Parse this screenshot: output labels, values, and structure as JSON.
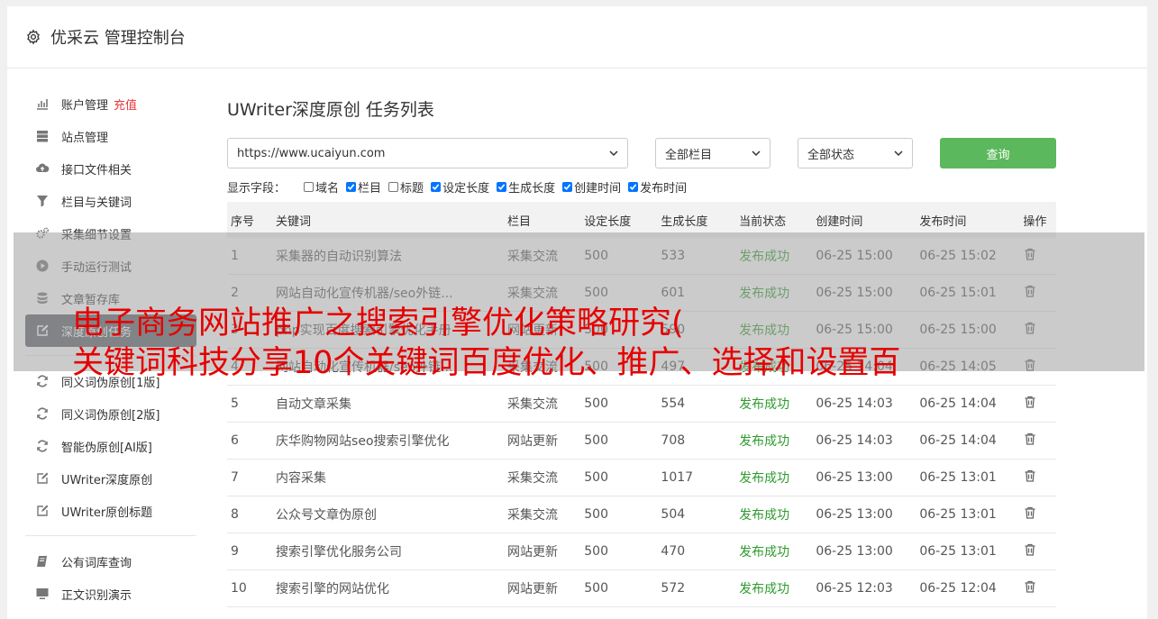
{
  "header": {
    "title": "优采云 管理控制台"
  },
  "sidebar": {
    "items": [
      {
        "label": "账户管理",
        "extra": "充值",
        "icon": "bar-chart-icon"
      },
      {
        "label": "站点管理",
        "icon": "server-icon"
      },
      {
        "label": "接口文件相关",
        "icon": "cloud-upload-icon"
      },
      {
        "label": "栏目与关键词",
        "icon": "filter-icon"
      },
      {
        "label": "采集细节设置",
        "icon": "gears-icon"
      },
      {
        "label": "手动运行测试",
        "icon": "play-icon"
      },
      {
        "label": "文章暂存库",
        "icon": "database-icon"
      },
      {
        "label": "深度原创任务",
        "icon": "edit-icon"
      }
    ],
    "items2": [
      {
        "label": "同义词伪原创[1版]",
        "icon": "refresh-icon"
      },
      {
        "label": "同义词伪原创[2版]",
        "icon": "refresh-icon"
      },
      {
        "label": "智能伪原创[AI版]",
        "icon": "refresh-icon"
      },
      {
        "label": "UWriter深度原创",
        "icon": "edit-icon"
      },
      {
        "label": "UWriter原创标题",
        "icon": "edit-icon"
      }
    ],
    "items3": [
      {
        "label": "公有词库查询",
        "icon": "book-icon"
      },
      {
        "label": "正文识别演示",
        "icon": "monitor-icon"
      }
    ]
  },
  "main": {
    "title": "UWriter深度原创 任务列表",
    "site_select": "https://www.ucaiyun.com",
    "column_select": "全部栏目",
    "status_select": "全部状态",
    "query_label": "查询",
    "fields_label": "显示字段：",
    "fields": [
      {
        "label": "域名",
        "checked": false
      },
      {
        "label": "栏目",
        "checked": true
      },
      {
        "label": "标题",
        "checked": false
      },
      {
        "label": "设定长度",
        "checked": true
      },
      {
        "label": "生成长度",
        "checked": true
      },
      {
        "label": "创建时间",
        "checked": true
      },
      {
        "label": "发布时间",
        "checked": true
      }
    ],
    "columns": [
      "序号",
      "关键词",
      "栏目",
      "设定长度",
      "生成长度",
      "当前状态",
      "创建时间",
      "发布时间",
      "操作"
    ],
    "rows": [
      [
        "1",
        "采集器的自动识别算法",
        "采集交流",
        "500",
        "533",
        "发布成功",
        "06-25 15:00",
        "06-25 15:02"
      ],
      [
        "2",
        "网站自动化宣传机器/seo外链...",
        "采集交流",
        "500",
        "601",
        "发布成功",
        "06-25 15:00",
        "06-25 15:01"
      ],
      [
        "3",
        "php实现百度搜索引擎优化手册",
        "网站更新",
        "500",
        "590",
        "发布成功",
        "06-25 15:00",
        "06-25 15:00"
      ],
      [
        "4",
        "网站自动化宣传机器/seo外链...",
        "采集交流",
        "500",
        "497",
        "发布成功",
        "06-25 14:04",
        "06-25 14:05"
      ],
      [
        "5",
        "自动文章采集",
        "采集交流",
        "500",
        "554",
        "发布成功",
        "06-25 14:03",
        "06-25 14:04"
      ],
      [
        "6",
        "庆华购物网站seo搜索引擎优化",
        "网站更新",
        "500",
        "708",
        "发布成功",
        "06-25 14:03",
        "06-25 14:04"
      ],
      [
        "7",
        "内容采集",
        "采集交流",
        "500",
        "1017",
        "发布成功",
        "06-25 13:00",
        "06-25 13:01"
      ],
      [
        "8",
        "公众号文章伪原创",
        "采集交流",
        "500",
        "504",
        "发布成功",
        "06-25 13:00",
        "06-25 13:01"
      ],
      [
        "9",
        "搜索引擎优化服务公司",
        "网站更新",
        "500",
        "470",
        "发布成功",
        "06-25 13:00",
        "06-25 13:01"
      ],
      [
        "10",
        "搜索引擎的网站优化",
        "网站更新",
        "500",
        "572",
        "发布成功",
        "06-25 12:03",
        "06-25 12:04"
      ]
    ]
  },
  "overlay": {
    "line1": "电子商务网站推广之搜索引擎优化策略研究(",
    "line2": "关键词科技分享10个关键词百度优化、推广、选择和设置百"
  },
  "colors": {
    "accent": "#5cb85c",
    "active_nav": "#5b6167",
    "success": "#2e9b2e",
    "recharge": "#e4393c",
    "overlay_text": "#e60000"
  }
}
